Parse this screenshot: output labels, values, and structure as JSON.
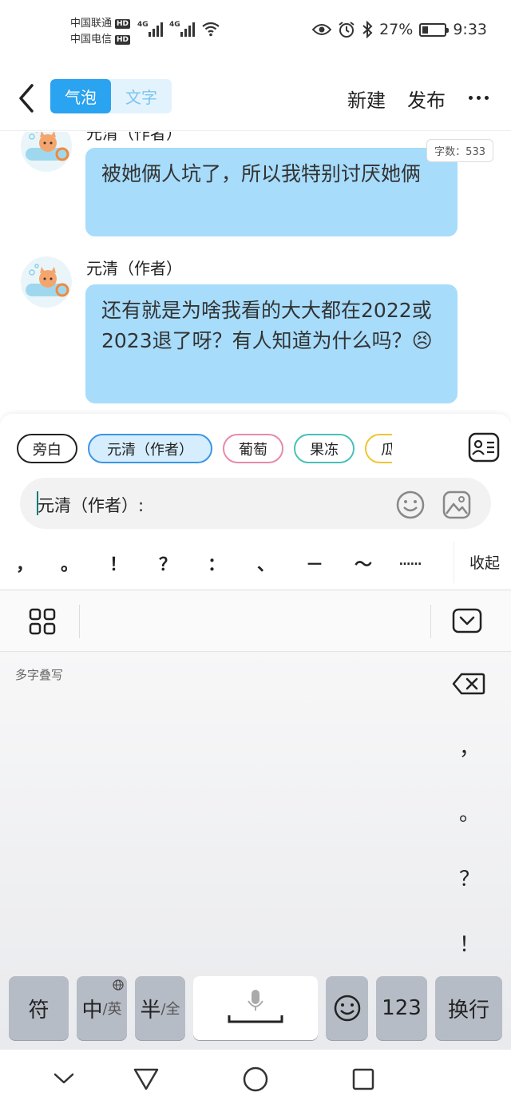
{
  "status_bar": {
    "carrier1": "中国联通",
    "carrier2": "中国电信",
    "hd_badge": "HD",
    "network": "4G",
    "battery_pct": "27%",
    "battery_level": 0.27,
    "time": "9:33"
  },
  "header": {
    "tab_bubble": "气泡",
    "tab_text": "文字",
    "new_label": "新建",
    "publish_label": "发布"
  },
  "chat": {
    "word_count": "字数：533",
    "messages": [
      {
        "speaker": "元清（作者）",
        "text": "被她俩人坑了，所以我特别讨厌她俩"
      },
      {
        "speaker": "元清（作者）",
        "text": "还有就是为啥我看的大大都在2022或2023退了呀？有人知道为什么吗？😣"
      }
    ]
  },
  "roles": [
    "旁白",
    "元清（作者）",
    "葡萄",
    "果冻",
    "瓜"
  ],
  "input": {
    "text": "元清（作者）:"
  },
  "punctuation": [
    "，",
    "。",
    "！",
    "？",
    "：",
    "、",
    "－",
    "～",
    "……"
  ],
  "collapse_label": "收起",
  "keyboard": {
    "hint": "多字叠写",
    "side_keys": [
      "，",
      "。",
      "？",
      "！"
    ],
    "keys": {
      "symbol": "符",
      "zh": "中",
      "zh_sub": "/英",
      "half": "半",
      "half_sub": "/全",
      "numbers": "123",
      "enter": "换行"
    }
  }
}
